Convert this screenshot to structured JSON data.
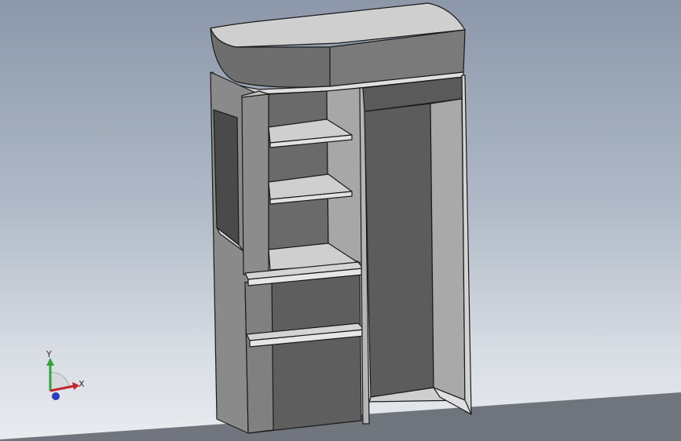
{
  "viewport": {
    "background_top": "#8c98aa",
    "background_bottom": "#e9ecef",
    "model": "wardrobe-cabinet"
  },
  "triad": {
    "x_label": "X",
    "y_label": "Y",
    "x_color": "#c0282d",
    "y_color": "#2ea43a",
    "z_color": "#2a3fbf"
  }
}
